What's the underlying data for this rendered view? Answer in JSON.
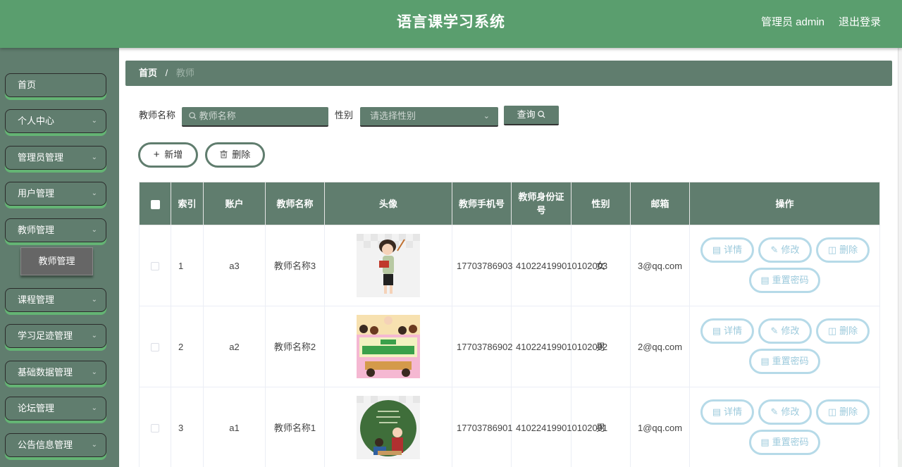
{
  "header": {
    "title": "语言课学习系统",
    "user": "管理员 admin",
    "logout": "退出登录"
  },
  "sidebar": {
    "items": [
      {
        "label": "首页",
        "has_arrow": false
      },
      {
        "label": "个人中心",
        "has_arrow": true
      },
      {
        "label": "管理员管理",
        "has_arrow": true
      },
      {
        "label": "用户管理",
        "has_arrow": true
      },
      {
        "label": "教师管理",
        "has_arrow": true
      },
      {
        "label": "课程管理",
        "has_arrow": true
      },
      {
        "label": "学习足迹管理",
        "has_arrow": true
      },
      {
        "label": "基础数据管理",
        "has_arrow": true
      },
      {
        "label": "论坛管理",
        "has_arrow": true
      },
      {
        "label": "公告信息管理",
        "has_arrow": true
      }
    ],
    "submenu": {
      "label": "教师管理"
    }
  },
  "breadcrumb": {
    "home": "首页",
    "separator": "/",
    "current": "教师"
  },
  "search": {
    "name_label": "教师名称",
    "name_placeholder": "教师名称",
    "gender_label": "性别",
    "gender_placeholder": "请选择性别",
    "query_label": "查询"
  },
  "actions": {
    "add_label": "新增",
    "delete_label": "删除"
  },
  "table": {
    "columns": [
      "索引",
      "账户",
      "教师名称",
      "头像",
      "教师手机号",
      "教师身份证号",
      "性别",
      "邮箱",
      "操作"
    ],
    "rows": [
      {
        "index": "1",
        "account": "a3",
        "name": "教师名称3",
        "phone": "17703786903",
        "id_number": "410224199010102003",
        "gender": "女",
        "email": "3@qq.com",
        "avatar": "teacher-reading-image"
      },
      {
        "index": "2",
        "account": "a2",
        "name": "教师名称2",
        "phone": "17703786902",
        "id_number": "410224199010102002",
        "gender": "男",
        "email": "2@qq.com",
        "avatar": "classroom-poster-image"
      },
      {
        "index": "3",
        "account": "a1",
        "name": "教师名称1",
        "phone": "17703786901",
        "id_number": "410224199010102001",
        "gender": "男",
        "email": "1@qq.com",
        "avatar": "chalkboard-teacher-image"
      }
    ],
    "row_actions": {
      "detail": "详情",
      "edit": "修改",
      "delete": "删除",
      "reset_password": "重置密码"
    }
  },
  "colors": {
    "header_bg": "#5a9e6e",
    "sidebar_bg": "#607d6e",
    "accent_green": "#64b474",
    "op_border": "#b6dae8"
  }
}
